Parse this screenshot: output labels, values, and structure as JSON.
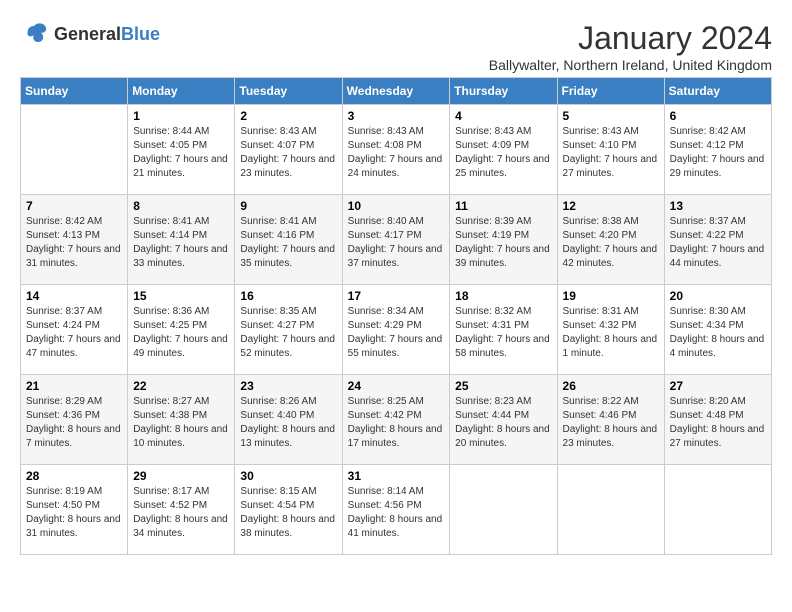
{
  "logo": {
    "general": "General",
    "blue": "Blue"
  },
  "title": "January 2024",
  "subtitle": "Ballywalter, Northern Ireland, United Kingdom",
  "days_header": [
    "Sunday",
    "Monday",
    "Tuesday",
    "Wednesday",
    "Thursday",
    "Friday",
    "Saturday"
  ],
  "weeks": [
    [
      {
        "day": "",
        "sunrise": "",
        "sunset": "",
        "daylight": ""
      },
      {
        "day": "1",
        "sunrise": "Sunrise: 8:44 AM",
        "sunset": "Sunset: 4:05 PM",
        "daylight": "Daylight: 7 hours and 21 minutes."
      },
      {
        "day": "2",
        "sunrise": "Sunrise: 8:43 AM",
        "sunset": "Sunset: 4:07 PM",
        "daylight": "Daylight: 7 hours and 23 minutes."
      },
      {
        "day": "3",
        "sunrise": "Sunrise: 8:43 AM",
        "sunset": "Sunset: 4:08 PM",
        "daylight": "Daylight: 7 hours and 24 minutes."
      },
      {
        "day": "4",
        "sunrise": "Sunrise: 8:43 AM",
        "sunset": "Sunset: 4:09 PM",
        "daylight": "Daylight: 7 hours and 25 minutes."
      },
      {
        "day": "5",
        "sunrise": "Sunrise: 8:43 AM",
        "sunset": "Sunset: 4:10 PM",
        "daylight": "Daylight: 7 hours and 27 minutes."
      },
      {
        "day": "6",
        "sunrise": "Sunrise: 8:42 AM",
        "sunset": "Sunset: 4:12 PM",
        "daylight": "Daylight: 7 hours and 29 minutes."
      }
    ],
    [
      {
        "day": "7",
        "sunrise": "Sunrise: 8:42 AM",
        "sunset": "Sunset: 4:13 PM",
        "daylight": "Daylight: 7 hours and 31 minutes."
      },
      {
        "day": "8",
        "sunrise": "Sunrise: 8:41 AM",
        "sunset": "Sunset: 4:14 PM",
        "daylight": "Daylight: 7 hours and 33 minutes."
      },
      {
        "day": "9",
        "sunrise": "Sunrise: 8:41 AM",
        "sunset": "Sunset: 4:16 PM",
        "daylight": "Daylight: 7 hours and 35 minutes."
      },
      {
        "day": "10",
        "sunrise": "Sunrise: 8:40 AM",
        "sunset": "Sunset: 4:17 PM",
        "daylight": "Daylight: 7 hours and 37 minutes."
      },
      {
        "day": "11",
        "sunrise": "Sunrise: 8:39 AM",
        "sunset": "Sunset: 4:19 PM",
        "daylight": "Daylight: 7 hours and 39 minutes."
      },
      {
        "day": "12",
        "sunrise": "Sunrise: 8:38 AM",
        "sunset": "Sunset: 4:20 PM",
        "daylight": "Daylight: 7 hours and 42 minutes."
      },
      {
        "day": "13",
        "sunrise": "Sunrise: 8:37 AM",
        "sunset": "Sunset: 4:22 PM",
        "daylight": "Daylight: 7 hours and 44 minutes."
      }
    ],
    [
      {
        "day": "14",
        "sunrise": "Sunrise: 8:37 AM",
        "sunset": "Sunset: 4:24 PM",
        "daylight": "Daylight: 7 hours and 47 minutes."
      },
      {
        "day": "15",
        "sunrise": "Sunrise: 8:36 AM",
        "sunset": "Sunset: 4:25 PM",
        "daylight": "Daylight: 7 hours and 49 minutes."
      },
      {
        "day": "16",
        "sunrise": "Sunrise: 8:35 AM",
        "sunset": "Sunset: 4:27 PM",
        "daylight": "Daylight: 7 hours and 52 minutes."
      },
      {
        "day": "17",
        "sunrise": "Sunrise: 8:34 AM",
        "sunset": "Sunset: 4:29 PM",
        "daylight": "Daylight: 7 hours and 55 minutes."
      },
      {
        "day": "18",
        "sunrise": "Sunrise: 8:32 AM",
        "sunset": "Sunset: 4:31 PM",
        "daylight": "Daylight: 7 hours and 58 minutes."
      },
      {
        "day": "19",
        "sunrise": "Sunrise: 8:31 AM",
        "sunset": "Sunset: 4:32 PM",
        "daylight": "Daylight: 8 hours and 1 minute."
      },
      {
        "day": "20",
        "sunrise": "Sunrise: 8:30 AM",
        "sunset": "Sunset: 4:34 PM",
        "daylight": "Daylight: 8 hours and 4 minutes."
      }
    ],
    [
      {
        "day": "21",
        "sunrise": "Sunrise: 8:29 AM",
        "sunset": "Sunset: 4:36 PM",
        "daylight": "Daylight: 8 hours and 7 minutes."
      },
      {
        "day": "22",
        "sunrise": "Sunrise: 8:27 AM",
        "sunset": "Sunset: 4:38 PM",
        "daylight": "Daylight: 8 hours and 10 minutes."
      },
      {
        "day": "23",
        "sunrise": "Sunrise: 8:26 AM",
        "sunset": "Sunset: 4:40 PM",
        "daylight": "Daylight: 8 hours and 13 minutes."
      },
      {
        "day": "24",
        "sunrise": "Sunrise: 8:25 AM",
        "sunset": "Sunset: 4:42 PM",
        "daylight": "Daylight: 8 hours and 17 minutes."
      },
      {
        "day": "25",
        "sunrise": "Sunrise: 8:23 AM",
        "sunset": "Sunset: 4:44 PM",
        "daylight": "Daylight: 8 hours and 20 minutes."
      },
      {
        "day": "26",
        "sunrise": "Sunrise: 8:22 AM",
        "sunset": "Sunset: 4:46 PM",
        "daylight": "Daylight: 8 hours and 23 minutes."
      },
      {
        "day": "27",
        "sunrise": "Sunrise: 8:20 AM",
        "sunset": "Sunset: 4:48 PM",
        "daylight": "Daylight: 8 hours and 27 minutes."
      }
    ],
    [
      {
        "day": "28",
        "sunrise": "Sunrise: 8:19 AM",
        "sunset": "Sunset: 4:50 PM",
        "daylight": "Daylight: 8 hours and 31 minutes."
      },
      {
        "day": "29",
        "sunrise": "Sunrise: 8:17 AM",
        "sunset": "Sunset: 4:52 PM",
        "daylight": "Daylight: 8 hours and 34 minutes."
      },
      {
        "day": "30",
        "sunrise": "Sunrise: 8:15 AM",
        "sunset": "Sunset: 4:54 PM",
        "daylight": "Daylight: 8 hours and 38 minutes."
      },
      {
        "day": "31",
        "sunrise": "Sunrise: 8:14 AM",
        "sunset": "Sunset: 4:56 PM",
        "daylight": "Daylight: 8 hours and 41 minutes."
      },
      {
        "day": "",
        "sunrise": "",
        "sunset": "",
        "daylight": ""
      },
      {
        "day": "",
        "sunrise": "",
        "sunset": "",
        "daylight": ""
      },
      {
        "day": "",
        "sunrise": "",
        "sunset": "",
        "daylight": ""
      }
    ]
  ]
}
